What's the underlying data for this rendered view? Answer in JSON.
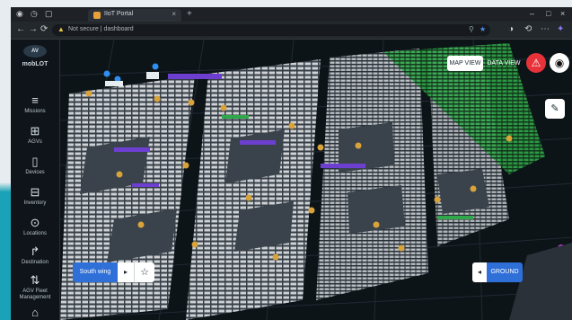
{
  "browser": {
    "tab_title": "IIoT Portal",
    "new_tab": "+",
    "tab_close": "×",
    "url_warning": "Not secure",
    "url_text": "Not secure  |  dashboard",
    "window_controls": [
      "–",
      "□",
      "×"
    ],
    "nav_back": "←",
    "nav_forward": "→",
    "nav_reload": "⟳"
  },
  "sidebar": {
    "logo_text": "AV",
    "brand": "mobLOT",
    "items": [
      {
        "icon": "menu-icon",
        "glyph": "≡",
        "label": "Missions"
      },
      {
        "icon": "agv-icon",
        "glyph": "⊞",
        "label": "AGVs"
      },
      {
        "icon": "device-icon",
        "glyph": "▯",
        "label": "Devices"
      },
      {
        "icon": "inventory-icon",
        "glyph": "⊟",
        "label": "Inventory"
      },
      {
        "icon": "location-icon",
        "glyph": "⊙",
        "label": "Locations"
      },
      {
        "icon": "route-icon",
        "glyph": "↱",
        "label": "Destination"
      },
      {
        "icon": "fleet-icon",
        "glyph": "⇅",
        "label": "AGV Fleet Management"
      },
      {
        "icon": "camera-icon",
        "glyph": "⌂",
        "label": ""
      }
    ]
  },
  "toolbar": {
    "map_view": "MAP VIEW",
    "data_view": "DATA VIEW",
    "alert_glyph": "⚠",
    "wifi_glyph": "◉",
    "edit_glyph": "✎"
  },
  "floor": {
    "wing_label": "South wing",
    "wing_next": "▸",
    "favorite_glyph": "☆",
    "ground_prev": "◂",
    "ground_label": "GROUND"
  },
  "colors": {
    "accent": "#2f6fd8",
    "alert": "#e8323a",
    "agv": "#d9a23a",
    "zone_purple": "#6d3fd1",
    "zone_green": "#2fa84a"
  }
}
